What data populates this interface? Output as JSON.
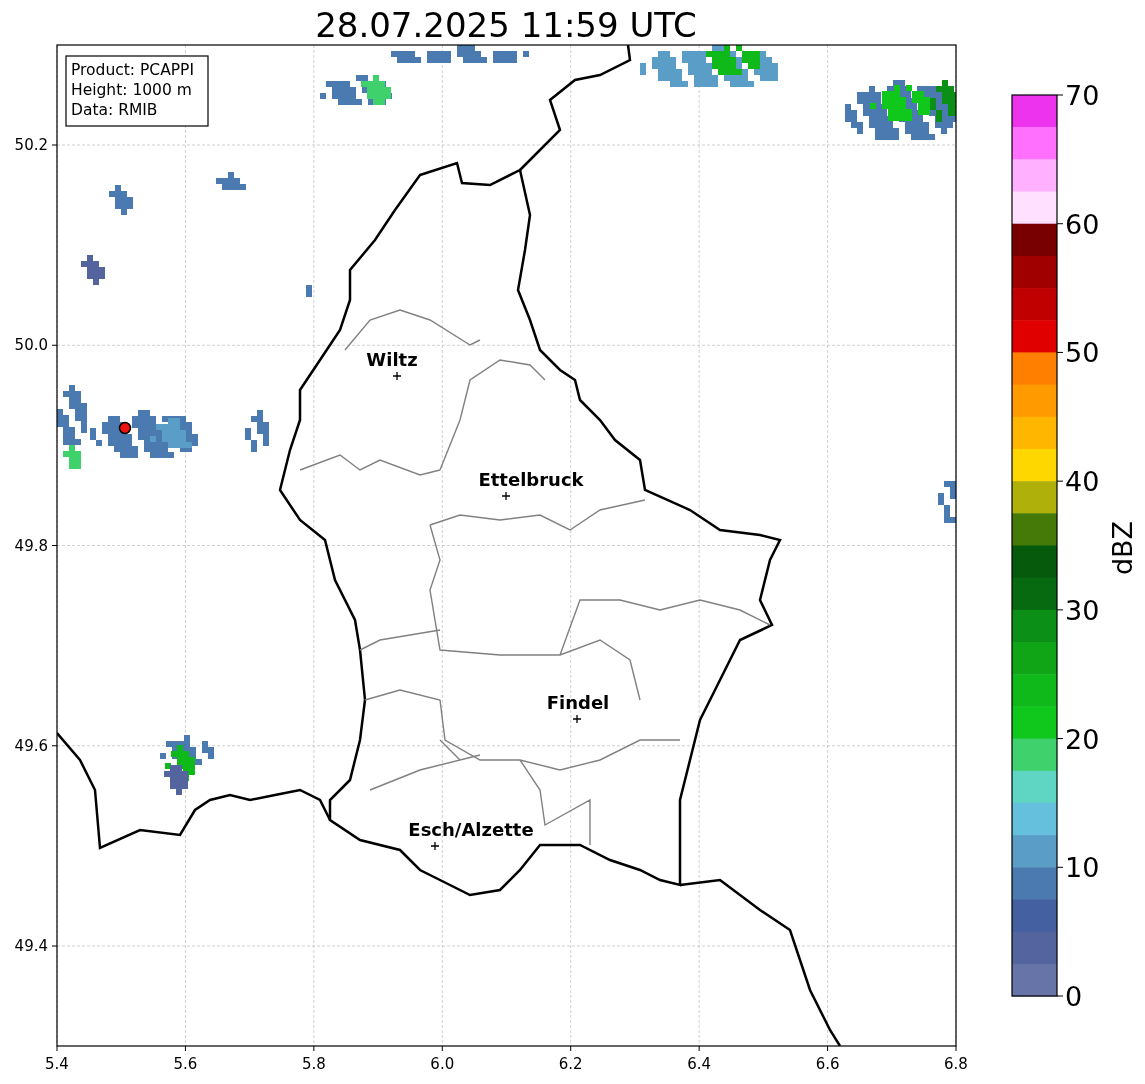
{
  "title": "28.07.2025 11:59 UTC",
  "info_box": [
    "Product: PCAPPI",
    "Height: 1000 m",
    "Data: RMIB"
  ],
  "cities": [
    {
      "name": "Wiltz"
    },
    {
      "name": "Ettelbruck"
    },
    {
      "name": "Findel"
    },
    {
      "name": "Esch/Alzette"
    }
  ],
  "x_axis": {
    "ticks": [
      "5.4",
      "5.6",
      "5.8",
      "6.0",
      "6.2",
      "6.4",
      "6.6",
      "6.8"
    ]
  },
  "y_axis": {
    "ticks": [
      "50.2",
      "50.0",
      "49.8",
      "49.6",
      "49.4"
    ]
  },
  "colorbar": {
    "label": "dBZ",
    "ticks": [
      "70",
      "60",
      "50",
      "40",
      "30",
      "20",
      "10",
      "0"
    ],
    "bins": [
      {
        "color": "#ee33ee"
      },
      {
        "color": "#ff70ff"
      },
      {
        "color": "#ffb0ff"
      },
      {
        "color": "#ffe0ff"
      },
      {
        "color": "#780000"
      },
      {
        "color": "#a00000"
      },
      {
        "color": "#c00000"
      },
      {
        "color": "#e00000"
      },
      {
        "color": "#ff7f00"
      },
      {
        "color": "#ff9a00"
      },
      {
        "color": "#ffb600"
      },
      {
        "color": "#ffd700"
      },
      {
        "color": "#b0b00a"
      },
      {
        "color": "#457a08"
      },
      {
        "color": "#055a0c"
      },
      {
        "color": "#086a10"
      },
      {
        "color": "#0c8f16"
      },
      {
        "color": "#0fa516"
      },
      {
        "color": "#10b91a"
      },
      {
        "color": "#10c81c"
      },
      {
        "color": "#3ed16c"
      },
      {
        "color": "#5fd6c4"
      },
      {
        "color": "#64c0dc"
      },
      {
        "color": "#5a9ec7"
      },
      {
        "color": "#4a7ab0"
      },
      {
        "color": "#4460a0"
      },
      {
        "color": "#53649f"
      },
      {
        "color": "#6674a8"
      }
    ]
  }
}
